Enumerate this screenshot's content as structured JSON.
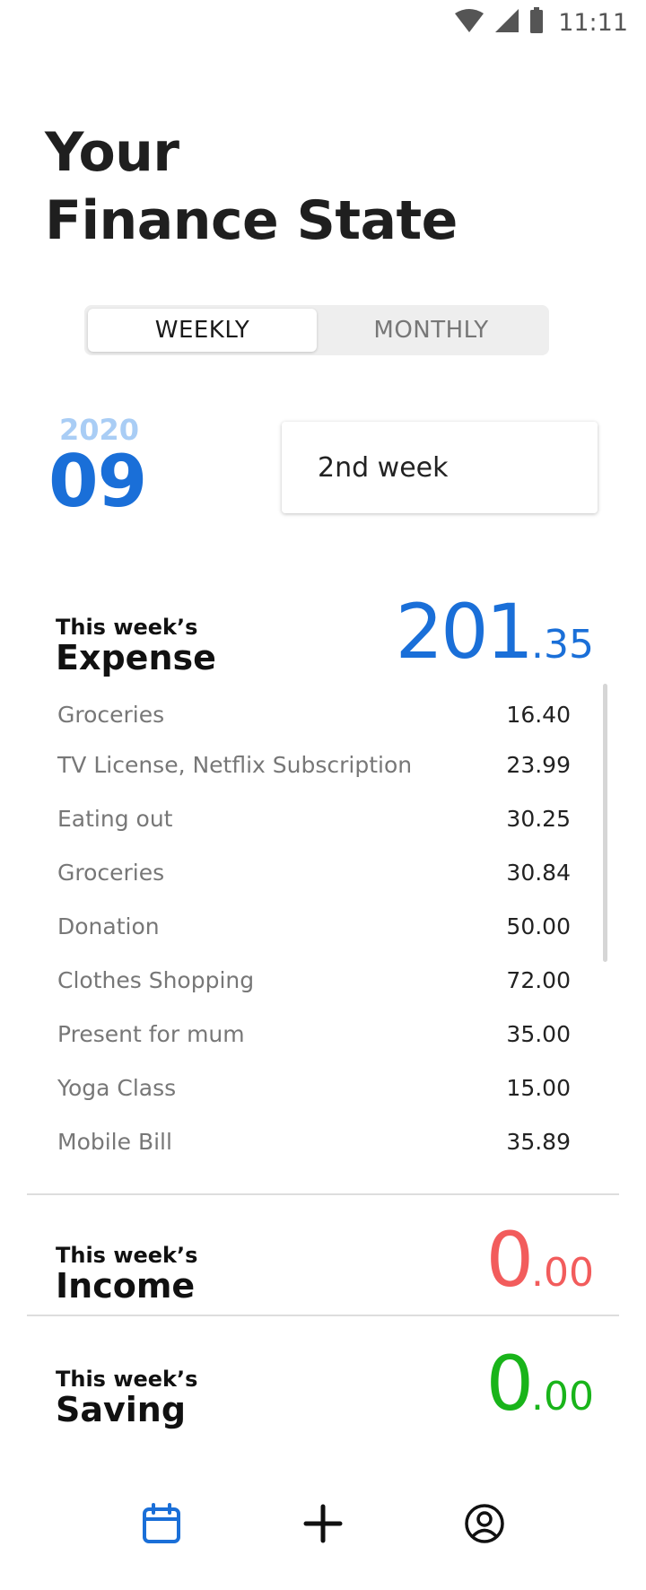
{
  "status_bar": {
    "time": "11:11",
    "icons": [
      "wifi-icon",
      "cell-signal-icon",
      "battery-icon"
    ]
  },
  "header": {
    "title_line1": "Your",
    "title_line2": "Finance State"
  },
  "tabs": [
    {
      "label": "WEEKLY",
      "selected": true
    },
    {
      "label": "MONTHLY",
      "selected": false
    }
  ],
  "date": {
    "year": "2020",
    "month": "09"
  },
  "week_selector": {
    "value": "2nd week"
  },
  "expense": {
    "label_small": "This week’s",
    "label_big": "Expense",
    "amount_int": "201",
    "amount_dec": ".35",
    "items": [
      {
        "name": "Groceries",
        "amount": "16.40"
      },
      {
        "name": "TV License, Netflix Subscription",
        "amount": "23.99"
      },
      {
        "name": "Eating out",
        "amount": "30.25"
      },
      {
        "name": "Groceries",
        "amount": "30.84"
      },
      {
        "name": "Donation",
        "amount": "50.00"
      },
      {
        "name": "Clothes Shopping",
        "amount": "72.00"
      },
      {
        "name": "Present for mum",
        "amount": "35.00"
      },
      {
        "name": "Yoga Class",
        "amount": "15.00"
      },
      {
        "name": "Mobile Bill",
        "amount": "35.89"
      }
    ]
  },
  "income": {
    "label_small": "This week’s",
    "label_big": "Income",
    "amount_int": "0",
    "amount_dec": ".00"
  },
  "saving": {
    "label_small": "This week’s",
    "label_big": "Saving",
    "amount_int": "0",
    "amount_dec": ".00"
  },
  "bottom_nav": {
    "items": [
      "calendar-icon",
      "plus-icon",
      "account-icon"
    ],
    "active": "calendar-icon"
  },
  "colors": {
    "accent_blue": "#1a6fd8",
    "year_light_blue": "#a9cdf5",
    "income_red": "#f25c5c",
    "saving_green": "#19b41a"
  }
}
